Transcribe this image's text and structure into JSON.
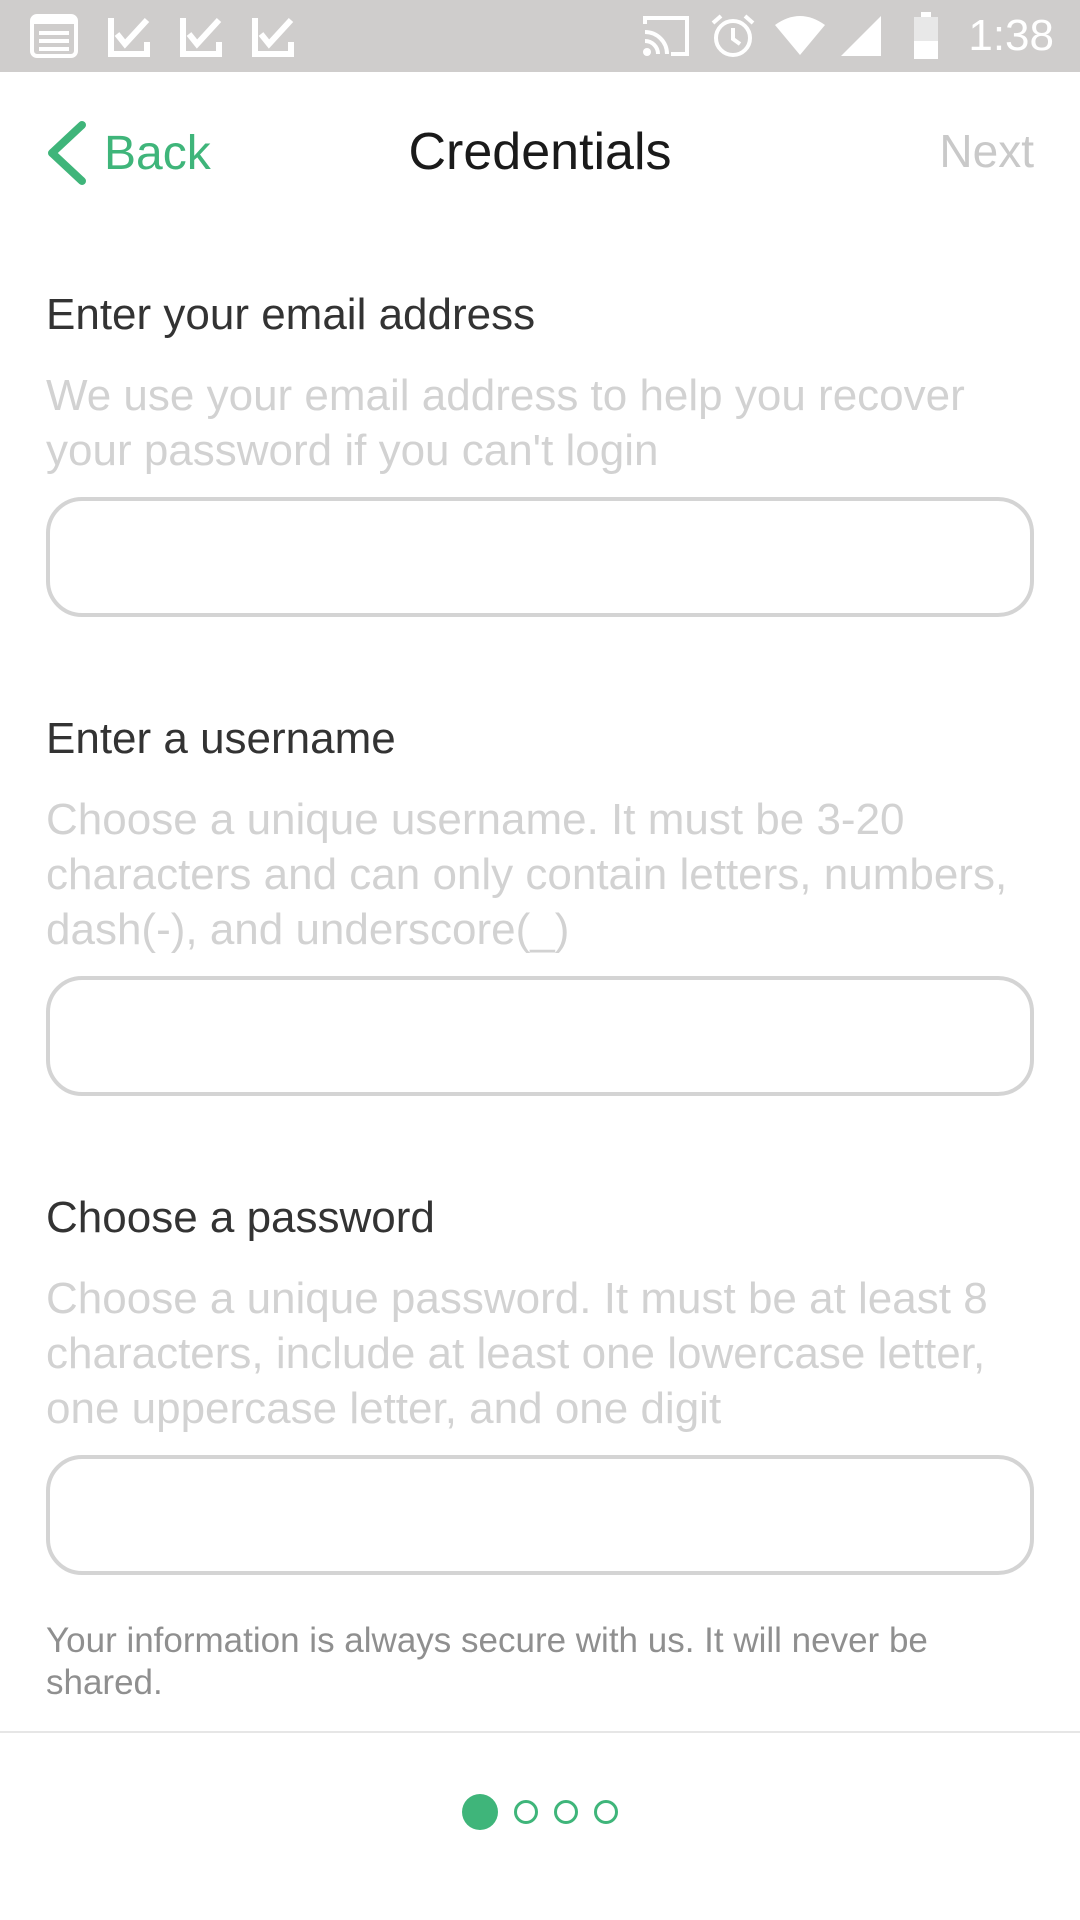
{
  "status_bar": {
    "time": "1:38",
    "icons": [
      "notification-list-icon",
      "checkmark-download-icon",
      "checkmark-download-icon",
      "checkmark-download-icon",
      "cast-icon",
      "alarm-icon",
      "wifi-icon",
      "cellular-signal-icon",
      "battery-icon"
    ]
  },
  "nav": {
    "back_label": "Back",
    "title": "Credentials",
    "next_label": "Next"
  },
  "form": {
    "email": {
      "label": "Enter your email address",
      "help": "We use your email address to help you recover your password if you can't login",
      "value": ""
    },
    "username": {
      "label": "Enter a username",
      "help": "Choose a unique username. It must be 3-20 characters and can only contain letters, numbers, dash(-), and underscore(_)",
      "value": ""
    },
    "password": {
      "label": "Choose a password",
      "help": "Choose a unique password. It must be at least 8 characters, include at least one lowercase letter, one uppercase letter, and one digit",
      "value": ""
    }
  },
  "secure_note": "Your information is always secure with us. It will never be shared.",
  "pagination": {
    "total": 4,
    "current": 1
  },
  "colors": {
    "accent": "#3fb57a",
    "status_bar": "#cfcdcc",
    "help_text": "#d2d2d2",
    "input_border": "#d4d4d4",
    "disabled": "#c9c9c9"
  }
}
